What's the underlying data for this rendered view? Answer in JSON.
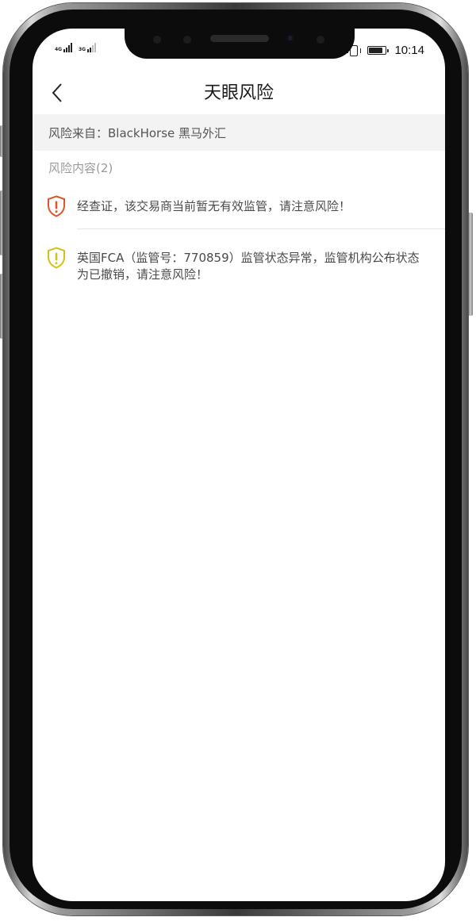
{
  "status_bar": {
    "signal_1_label": "4G",
    "signal_2_label": "3G",
    "time": "10:14"
  },
  "nav": {
    "title": "天眼风险",
    "back_icon": "chevron-left-icon"
  },
  "source": {
    "text": "风险来自：BlackHorse 黑马外汇"
  },
  "risk": {
    "header": "风险内容(2)",
    "items": [
      {
        "level": "high",
        "color": "#e0532d",
        "icon": "shield-alert-icon",
        "text": "经查证，该交易商当前暂无有效监管，请注意风险！"
      },
      {
        "level": "medium",
        "color": "#d4c21a",
        "icon": "shield-alert-icon",
        "text": "英国FCA（监管号：770859）监管状态异常，监管机构公布状态为已撤销，请注意风险！"
      }
    ]
  }
}
